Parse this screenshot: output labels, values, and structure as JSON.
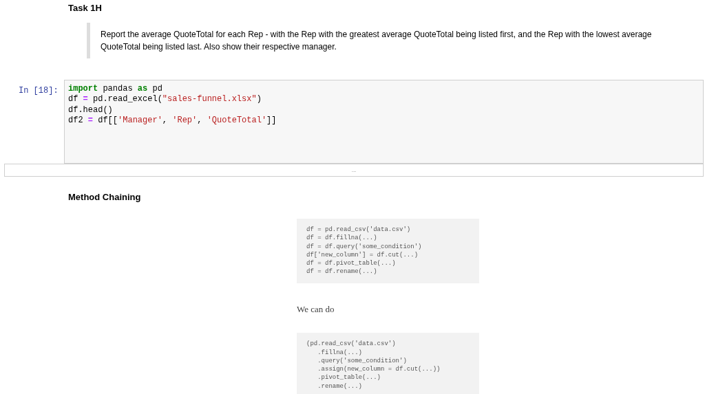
{
  "task_heading": "Task 1H",
  "task_quote": "Report the average QuoteTotal for each Rep - with the Rep with the greatest average QuoteTotal being listed first, and the Rep with the lowest average QuoteTotal being listed last. Also show their respective manager.",
  "code_cell": {
    "prompt": "In [18]:",
    "lines": [
      [
        {
          "kind": "keyword",
          "text": "import"
        },
        {
          "kind": "plain",
          "text": " pandas "
        },
        {
          "kind": "keyword",
          "text": "as"
        },
        {
          "kind": "plain",
          "text": " pd"
        }
      ],
      [
        {
          "kind": "plain",
          "text": "df "
        },
        {
          "kind": "operator",
          "text": "="
        },
        {
          "kind": "plain",
          "text": " pd.read_excel("
        },
        {
          "kind": "string",
          "text": "\"sales-funnel.xlsx\""
        },
        {
          "kind": "plain",
          "text": ")"
        }
      ],
      [
        {
          "kind": "plain",
          "text": "df.head()"
        }
      ],
      [
        {
          "kind": "plain",
          "text": "df2 "
        },
        {
          "kind": "operator",
          "text": "="
        },
        {
          "kind": "plain",
          "text": " df[["
        },
        {
          "kind": "string",
          "text": "'Manager'"
        },
        {
          "kind": "plain",
          "text": ", "
        },
        {
          "kind": "string",
          "text": "'Rep'"
        },
        {
          "kind": "plain",
          "text": ", "
        },
        {
          "kind": "string",
          "text": "'QuoteTotal'"
        },
        {
          "kind": "plain",
          "text": "]]"
        }
      ]
    ]
  },
  "collapsed_output": {
    "label": "..."
  },
  "section_heading": "Method Chaining",
  "code_image_1": [
    "df = pd.read_csv('data.csv')",
    "df = df.fillna(...)",
    "df = df.query('some_condition')",
    "df['new_column'] = df.cut(...)",
    "df = df.pivot_table(...)",
    "df = df.rename(...)"
  ],
  "paragraph": "We can do",
  "code_image_2": [
    "(pd.read_csv('data.csv')",
    "   .fillna(...)",
    "   .query('some_condition')",
    "   .assign(new_column = df.cut(...))",
    "   .pivot_table(...)",
    "   .rename(...)"
  ]
}
